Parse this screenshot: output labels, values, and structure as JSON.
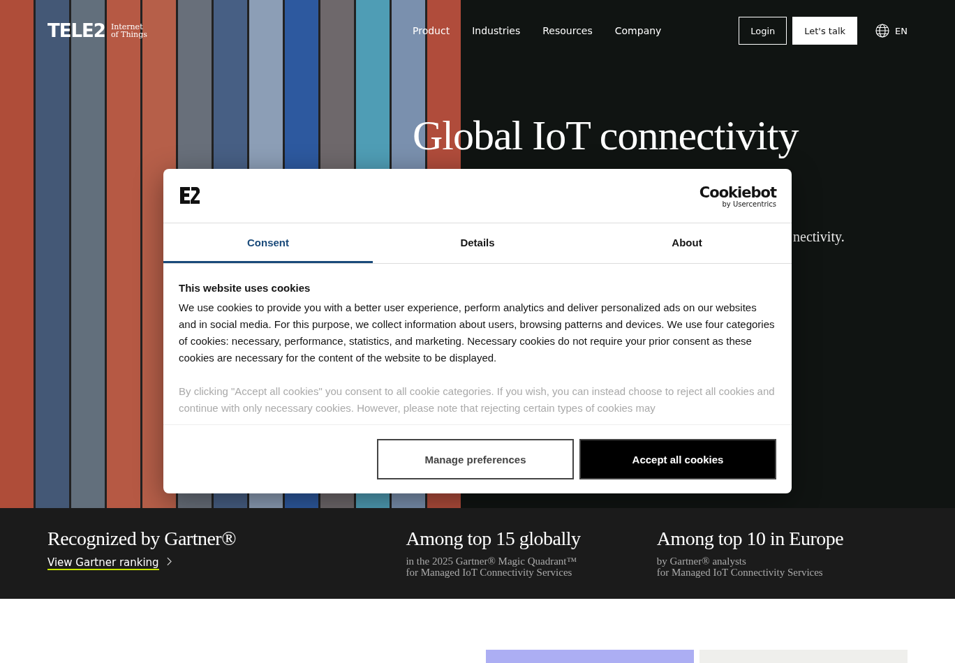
{
  "header": {
    "logo": {
      "wordmark": "TELE2",
      "tagline_line_1": "Internet",
      "tagline_line_2": "of Things"
    },
    "nav": [
      "Product",
      "Industries",
      "Resources",
      "Company"
    ],
    "login": "Login",
    "cta": "Let's talk",
    "language": "EN"
  },
  "hero": {
    "title": "Global IoT connectivity",
    "subtitle_fragment": "nectivity."
  },
  "cookie_dialog": {
    "brand": "Cookiebot",
    "brand_sub": "by Usercentrics",
    "tabs": [
      {
        "label": "Consent",
        "selected": true
      },
      {
        "label": "Details",
        "selected": false
      },
      {
        "label": "About",
        "selected": false
      }
    ],
    "heading": "This website uses cookies",
    "paragraphs": [
      "We use cookies to provide you with a better user experience, perform analytics and deliver personalized ads on our websites and in social media. For this purpose, we collect information about users, browsing patterns and devices. We use four categories of cookies: necessary, performance, statistics, and marketing. Necessary cookies do not require your prior consent as these cookies are necessary for the content of the website to be displayed.",
      "By clicking \"Accept all cookies\" you consent to all cookie categories. If you wish, you can instead choose to reject all cookies and continue with only necessary cookies. However, please note that rejecting certain types of cookies may"
    ],
    "manage_button": "Manage preferences",
    "accept_button": "Accept all cookies"
  },
  "stats": [
    {
      "title": "Recognized by Gartner®",
      "link": "View Gartner ranking"
    },
    {
      "title": "Among top 15 globally",
      "line_1": "in the 2025 Gartner® Magic Quadrant™",
      "line_2": "for Managed IoT Connectivity Services"
    },
    {
      "title": "Among top 10 in Europe",
      "line_1": "by Gartner® analysts",
      "line_2": "for Managed IoT Connectivity Services"
    }
  ]
}
